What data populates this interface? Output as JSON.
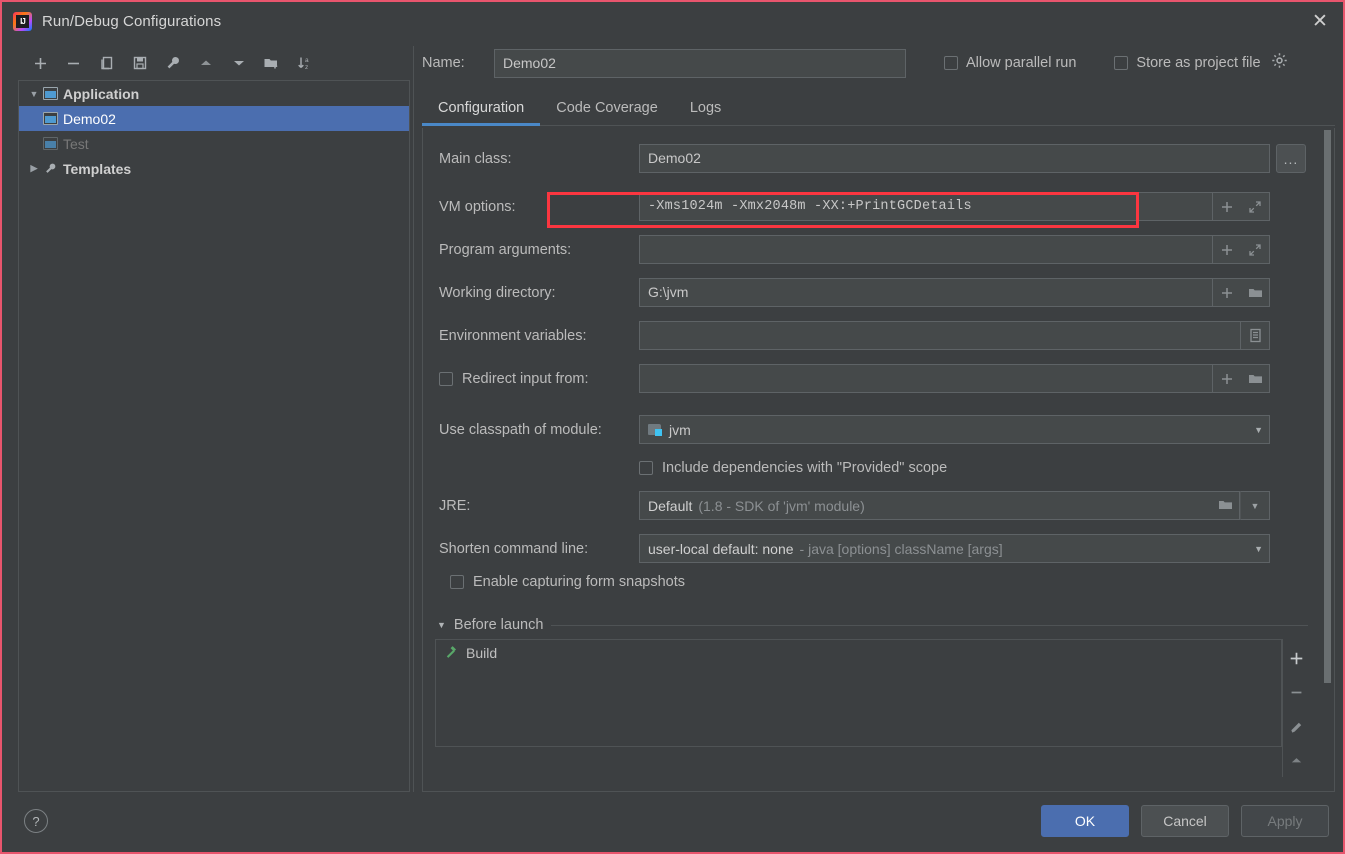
{
  "window": {
    "title": "Run/Debug Configurations",
    "app_icon": "intellij-idea-logo",
    "close_icon": "✕"
  },
  "left_panel": {
    "toolbar": [
      {
        "name": "add-configuration-button",
        "icon": "plus-icon",
        "label": "+"
      },
      {
        "name": "remove-configuration-button",
        "icon": "minus-icon",
        "label": "−"
      },
      {
        "name": "copy-configuration-button",
        "icon": "copy-icon",
        "label": "copy"
      },
      {
        "name": "save-configuration-button",
        "icon": "save-icon",
        "label": "save"
      },
      {
        "name": "edit-templates-button",
        "icon": "wrench-icon",
        "label": "wrench"
      },
      {
        "name": "move-up-button",
        "icon": "triangle-up-icon",
        "label": "up"
      },
      {
        "name": "move-down-button",
        "icon": "triangle-down-icon",
        "label": "down"
      },
      {
        "name": "new-folder-button",
        "icon": "folder-add-icon",
        "label": "folder+"
      },
      {
        "name": "sort-configurations-button",
        "icon": "sort-az-icon",
        "label": "sort a-z"
      }
    ],
    "tree": [
      {
        "label": "Application",
        "level": 0,
        "state": "expanded",
        "selected": false,
        "icon": "application-icon",
        "twisty": "▼"
      },
      {
        "label": "Demo02",
        "level": 1,
        "state": "leaf",
        "selected": true,
        "icon": "application-icon",
        "twisty": ""
      },
      {
        "label": "Test",
        "level": 1,
        "state": "leaf",
        "selected": false,
        "icon": "application-icon",
        "twisty": ""
      },
      {
        "label": "Templates",
        "level": 0,
        "state": "collapsed",
        "selected": false,
        "icon": "wrench-icon",
        "twisty": "▶"
      }
    ]
  },
  "header": {
    "name_label": "Name:",
    "name_value": "Demo02",
    "name_placeholder": "Name",
    "allow_parallel_run": {
      "label": "Allow parallel run",
      "checked": false
    },
    "store_as_project_file": {
      "label": "Store as project file",
      "checked": false
    },
    "gear_icon": "gear-icon"
  },
  "tabs": [
    {
      "label": "Configuration",
      "active": true
    },
    {
      "label": "Code Coverage",
      "active": false
    },
    {
      "label": "Logs",
      "active": false
    }
  ],
  "form": {
    "main_class": {
      "label": "Main class:",
      "value": "Demo02",
      "browse": "..."
    },
    "vm_options": {
      "label": "VM options:",
      "value": "-Xms1024m -Xmx2048m -XX:+PrintGCDetails",
      "macro_icon": "plus-icon",
      "expand_icon": "expand-icon"
    },
    "program_arguments": {
      "label": "Program arguments:",
      "value": "",
      "macro_icon": "plus-icon",
      "expand_icon": "expand-icon"
    },
    "working_directory": {
      "label": "Working directory:",
      "value": "G:\\jvm",
      "macro_icon": "plus-icon",
      "browse_icon": "folder-icon"
    },
    "environment_variables": {
      "label": "Environment variables:",
      "value": "",
      "edit_icon": "list-edit-icon"
    },
    "redirect_input": {
      "label": "Redirect input from:",
      "checked": false,
      "value": "",
      "macro_icon": "plus-icon",
      "browse_icon": "folder-icon"
    },
    "use_classpath_of_module": {
      "label": "Use classpath of module:",
      "value": "jvm",
      "icon": "module-icon",
      "caret": "▼"
    },
    "include_provided_scope": {
      "label": "Include dependencies with \"Provided\" scope",
      "checked": false
    },
    "jre": {
      "label": "JRE:",
      "value": "Default",
      "hint": "(1.8 - SDK of 'jvm' module)",
      "browse_icon": "folder-icon",
      "caret": "▼"
    },
    "shorten_command_line": {
      "label": "Shorten command line:",
      "value": "user-local default: none",
      "hint": "- java [options] className [args]",
      "caret": "▼"
    },
    "enable_form_snapshots": {
      "label": "Enable capturing form snapshots",
      "checked": false
    }
  },
  "before_launch": {
    "title": "Before launch",
    "twisty": "▼",
    "items": [
      {
        "label": "Build",
        "icon": "build-hammer-icon"
      }
    ],
    "tools": [
      {
        "name": "add-task-button",
        "icon": "plus-icon",
        "label": "+"
      },
      {
        "name": "remove-task-button",
        "icon": "minus-icon",
        "label": "−"
      },
      {
        "name": "edit-task-button",
        "icon": "pencil-icon",
        "label": "edit"
      },
      {
        "name": "move-task-up-button",
        "icon": "triangle-up-icon",
        "label": "up"
      }
    ]
  },
  "footer": {
    "help_label": "?",
    "ok_label": "OK",
    "cancel_label": "Cancel",
    "apply_label": "Apply"
  },
  "colors": {
    "background": "#3c3f41",
    "field_background": "#45494a",
    "accent_selection": "#4b6eaf",
    "tab_underline": "#4a88c7",
    "annotation_red": "#fb3640",
    "window_border": "#e8556d",
    "module_badge": "#3fc3f2",
    "build_icon_green": "#59a869"
  },
  "annotation": {
    "name": "vm-options-highlight",
    "shape": "rectangle",
    "color": "#fb3640"
  }
}
